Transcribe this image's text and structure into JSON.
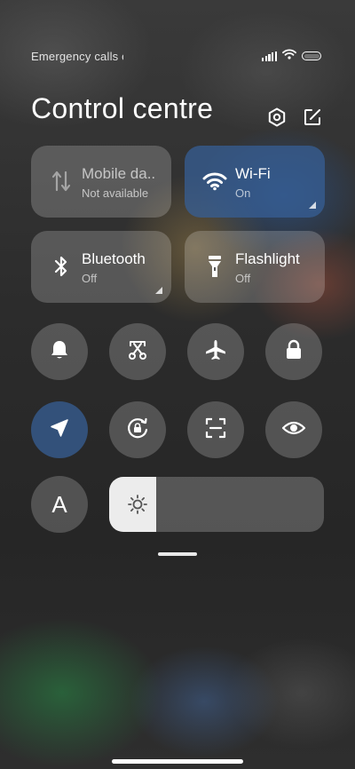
{
  "status_bar": {
    "carrier_text": "Emergency calls o",
    "icons": [
      "signal-icon",
      "wifi-icon",
      "battery-icon"
    ]
  },
  "header": {
    "title": "Control centre",
    "icons": [
      "settings-icon",
      "edit-icon"
    ]
  },
  "tiles": [
    {
      "name": "mobile-data",
      "label": "Mobile da..",
      "status": "Not available",
      "state": "unavailable",
      "icon": "mobile-data-icon"
    },
    {
      "name": "wifi",
      "label": "Wi-Fi",
      "status": "On",
      "state": "on",
      "icon": "wifi-icon"
    },
    {
      "name": "bluetooth",
      "label": "Bluetooth",
      "status": "Off",
      "state": "off",
      "icon": "bluetooth-icon"
    },
    {
      "name": "flashlight",
      "label": "Flashlight",
      "status": "Off",
      "state": "off",
      "icon": "flashlight-icon"
    }
  ],
  "toggles": [
    {
      "name": "sound",
      "icon": "bell-icon",
      "active": false
    },
    {
      "name": "screenshot",
      "icon": "scissors-screenshot-icon",
      "active": false
    },
    {
      "name": "airplane-mode",
      "icon": "airplane-icon",
      "active": false
    },
    {
      "name": "lock-screen",
      "icon": "lock-icon",
      "active": false
    },
    {
      "name": "location",
      "icon": "location-arrow-icon",
      "active": true
    },
    {
      "name": "rotation-lock",
      "icon": "rotation-lock-icon",
      "active": false
    },
    {
      "name": "scanner",
      "icon": "scan-icon",
      "active": false
    },
    {
      "name": "reading-mode",
      "icon": "eye-icon",
      "active": false
    },
    {
      "name": "auto-brightness",
      "icon": "letter-a-icon",
      "active": false,
      "label": "A"
    }
  ],
  "brightness": {
    "icon": "sun-icon",
    "level_fraction": 0.22
  },
  "colors": {
    "accent_active": "#375f96",
    "tile_bg": "rgba(255,255,255,0.2)",
    "brightness_fill": "#ececec"
  }
}
